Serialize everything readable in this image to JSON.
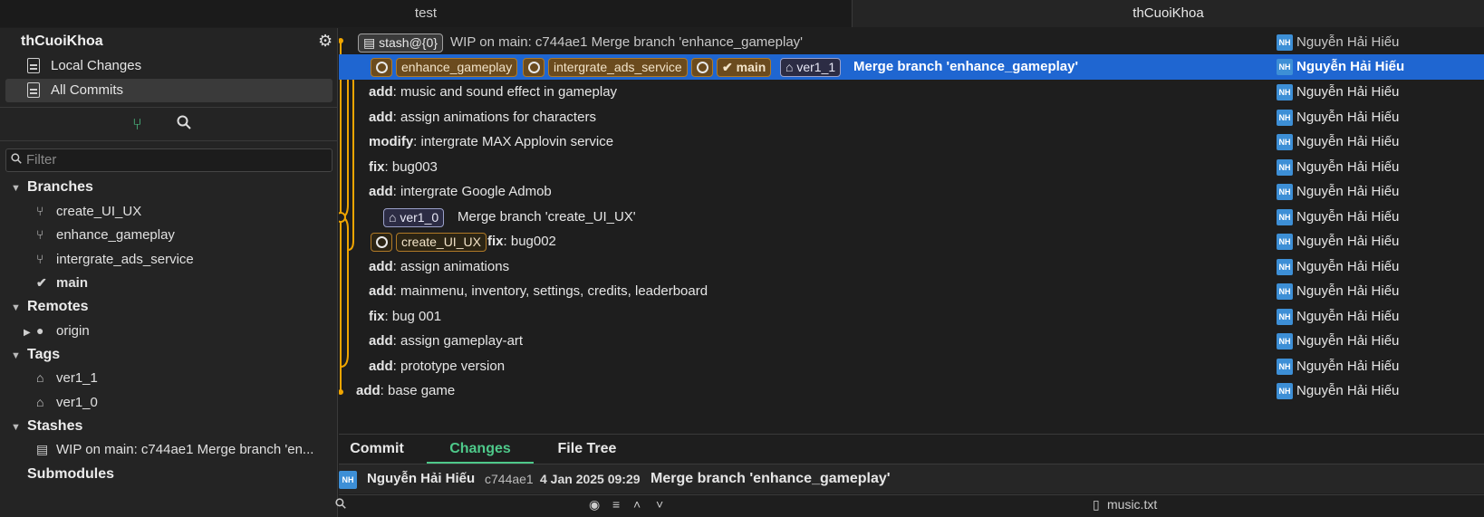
{
  "tabs": [
    "test",
    "thCuoiKhoa"
  ],
  "sidebar": {
    "repo_name": "thCuoiKhoa",
    "nav": [
      "Local Changes",
      "All Commits"
    ],
    "filter_placeholder": "Filter",
    "branches_header": "Branches",
    "branches": [
      "create_UI_UX",
      "enhance_gameplay",
      "intergrate_ads_service",
      "main"
    ],
    "remotes_header": "Remotes",
    "remotes": [
      "origin"
    ],
    "tags_header": "Tags",
    "tags": [
      "ver1_1",
      "ver1_0"
    ],
    "stashes_header": "Stashes",
    "stashes": [
      "WIP on main: c744ae1 Merge branch 'en..."
    ],
    "submodules_header": "Submodules"
  },
  "commits": [
    {
      "prefix": "",
      "msg": "WIP on main: c744ae1 Merge branch 'enhance_gameplay'",
      "author": "Nguyễn Hải Hiếu",
      "stash": "stash@{0}"
    },
    {
      "prefix": "",
      "msg": "Merge branch 'enhance_gameplay'",
      "author": "Nguyễn Hải Hiếu",
      "branches": [
        "enhance_gameplay",
        "intergrate_ads_service",
        "main"
      ],
      "tag": "ver1_1"
    },
    {
      "prefix": "add",
      "msg": ": music and sound effect in gameplay",
      "author": "Nguyễn Hải Hiếu"
    },
    {
      "prefix": "add",
      "msg": ": assign animations for characters",
      "author": "Nguyễn Hải Hiếu"
    },
    {
      "prefix": "modify",
      "msg": ": intergrate MAX Applovin service",
      "author": "Nguyễn Hải Hiếu"
    },
    {
      "prefix": "fix",
      "msg": ": bug003",
      "author": "Nguyễn Hải Hiếu"
    },
    {
      "prefix": "add",
      "msg": ": intergrate Google Admob",
      "author": "Nguyễn Hải Hiếu"
    },
    {
      "prefix": "",
      "msg": "Merge branch 'create_UI_UX'",
      "author": "Nguyễn Hải Hiếu",
      "tag": "ver1_0"
    },
    {
      "prefix": "fix",
      "msg": ": bug002",
      "author": "Nguyễn Hải Hiếu",
      "branch": "create_UI_UX"
    },
    {
      "prefix": "add",
      "msg": ": assign animations",
      "author": "Nguyễn Hải Hiếu"
    },
    {
      "prefix": "add",
      "msg": ": mainmenu, inventory, settings, credits, leaderboard",
      "author": "Nguyễn Hải Hiếu"
    },
    {
      "prefix": "fix",
      "msg": ": bug 001",
      "author": "Nguyễn Hải Hiếu"
    },
    {
      "prefix": "add",
      "msg": ": assign gameplay-art",
      "author": "Nguyễn Hải Hiếu"
    },
    {
      "prefix": "add",
      "msg": ": prototype version",
      "author": "Nguyễn Hải Hiếu"
    },
    {
      "prefix": "add",
      "msg": ": base game",
      "author": "Nguyễn Hải Hiếu"
    }
  ],
  "avatar_initials": "NH",
  "bottom": {
    "tabs": [
      "Commit",
      "Changes",
      "File Tree"
    ],
    "author": "Nguyễn Hải Hiếu",
    "hash": "c744ae1",
    "date": "4 Jan 2025 09:29",
    "message": "Merge branch 'enhance_gameplay'",
    "file": "music.txt"
  },
  "colors": {
    "accent_selected": "#1f66d1",
    "graph_line": "#f0a500",
    "changes_tab": "#4ec98a"
  }
}
